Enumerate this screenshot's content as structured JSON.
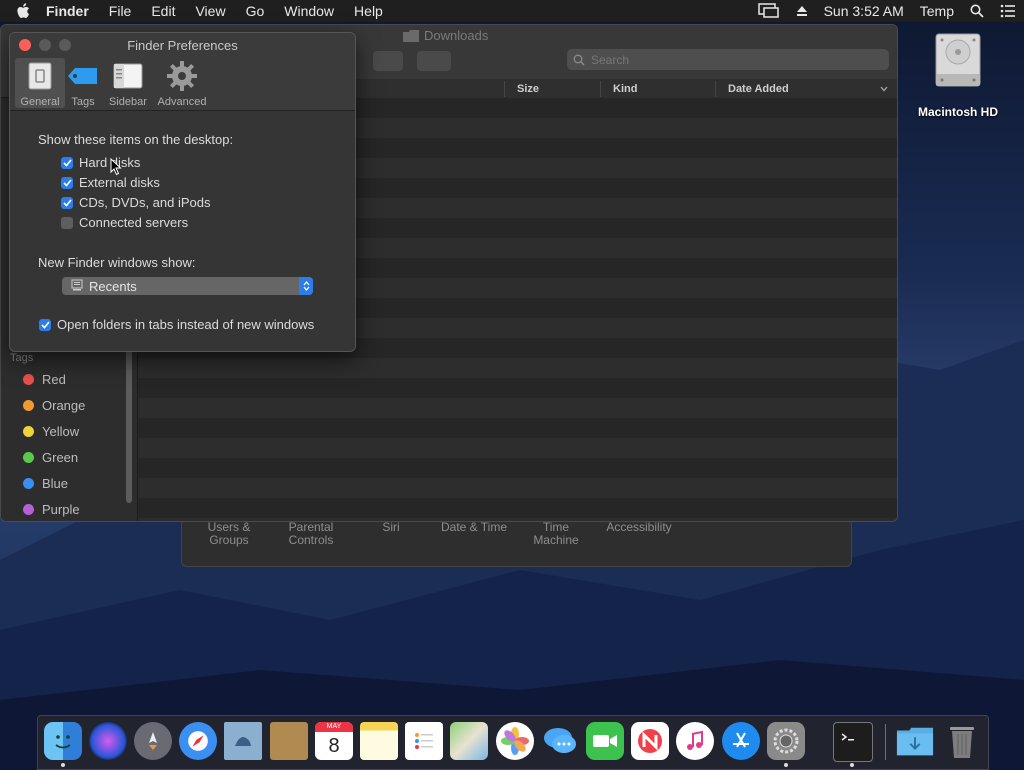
{
  "menubar": {
    "app_name": "Finder",
    "menus": [
      "File",
      "Edit",
      "View",
      "Go",
      "Window",
      "Help"
    ],
    "clock": "Sun 3:52 AM",
    "user": "Temp"
  },
  "desktop": {
    "drive_label": "Macintosh HD"
  },
  "sysprefs": {
    "items": [
      "Users &\nGroups",
      "Parental\nControls",
      "Siri",
      "Date & Time",
      "Time\nMachine",
      "Accessibility"
    ]
  },
  "finder": {
    "title": "Downloads",
    "search_placeholder": "Search",
    "columns": [
      "Size",
      "Kind",
      "Date Added"
    ],
    "sidebar_tags_header": "Tags",
    "tags": [
      {
        "name": "Red",
        "color": "#e8514f"
      },
      {
        "name": "Orange",
        "color": "#f09a36"
      },
      {
        "name": "Yellow",
        "color": "#eed33c"
      },
      {
        "name": "Green",
        "color": "#5bc84d"
      },
      {
        "name": "Blue",
        "color": "#3a8ff0"
      },
      {
        "name": "Purple",
        "color": "#b561d6"
      }
    ]
  },
  "prefs": {
    "title": "Finder Preferences",
    "tabs": [
      {
        "label": "General",
        "icon": "general-switch-icon",
        "selected": true
      },
      {
        "label": "Tags",
        "icon": "tag-icon",
        "selected": false
      },
      {
        "label": "Sidebar",
        "icon": "sidebar-icon",
        "selected": false
      },
      {
        "label": "Advanced",
        "icon": "gear-icon",
        "selected": false
      }
    ],
    "desktop_heading": "Show these items on the desktop:",
    "desktop_items": [
      {
        "label": "Hard disks",
        "checked": true
      },
      {
        "label": "External disks",
        "checked": true
      },
      {
        "label": "CDs, DVDs, and iPods",
        "checked": true
      },
      {
        "label": "Connected servers",
        "checked": false
      }
    ],
    "new_window_heading": "New Finder windows show:",
    "new_window_value": "Recents",
    "tabs_option": {
      "label": "Open folders in tabs instead of new windows",
      "checked": true
    }
  },
  "dock": {
    "apps": [
      "finder-icon",
      "siri-icon",
      "launchpad-icon",
      "safari-icon",
      "mail-icon",
      "contacts-icon",
      "calendar-icon",
      "notes-icon",
      "reminders-icon",
      "maps-icon",
      "photos-icon",
      "messages-icon",
      "facetime-icon",
      "news-icon",
      "itunes-icon",
      "app-store-icon",
      "system-preferences-icon",
      "terminal-icon",
      "downloads-folder-icon",
      "trash-icon"
    ],
    "calendar_month": "MAY",
    "calendar_day": "8"
  }
}
